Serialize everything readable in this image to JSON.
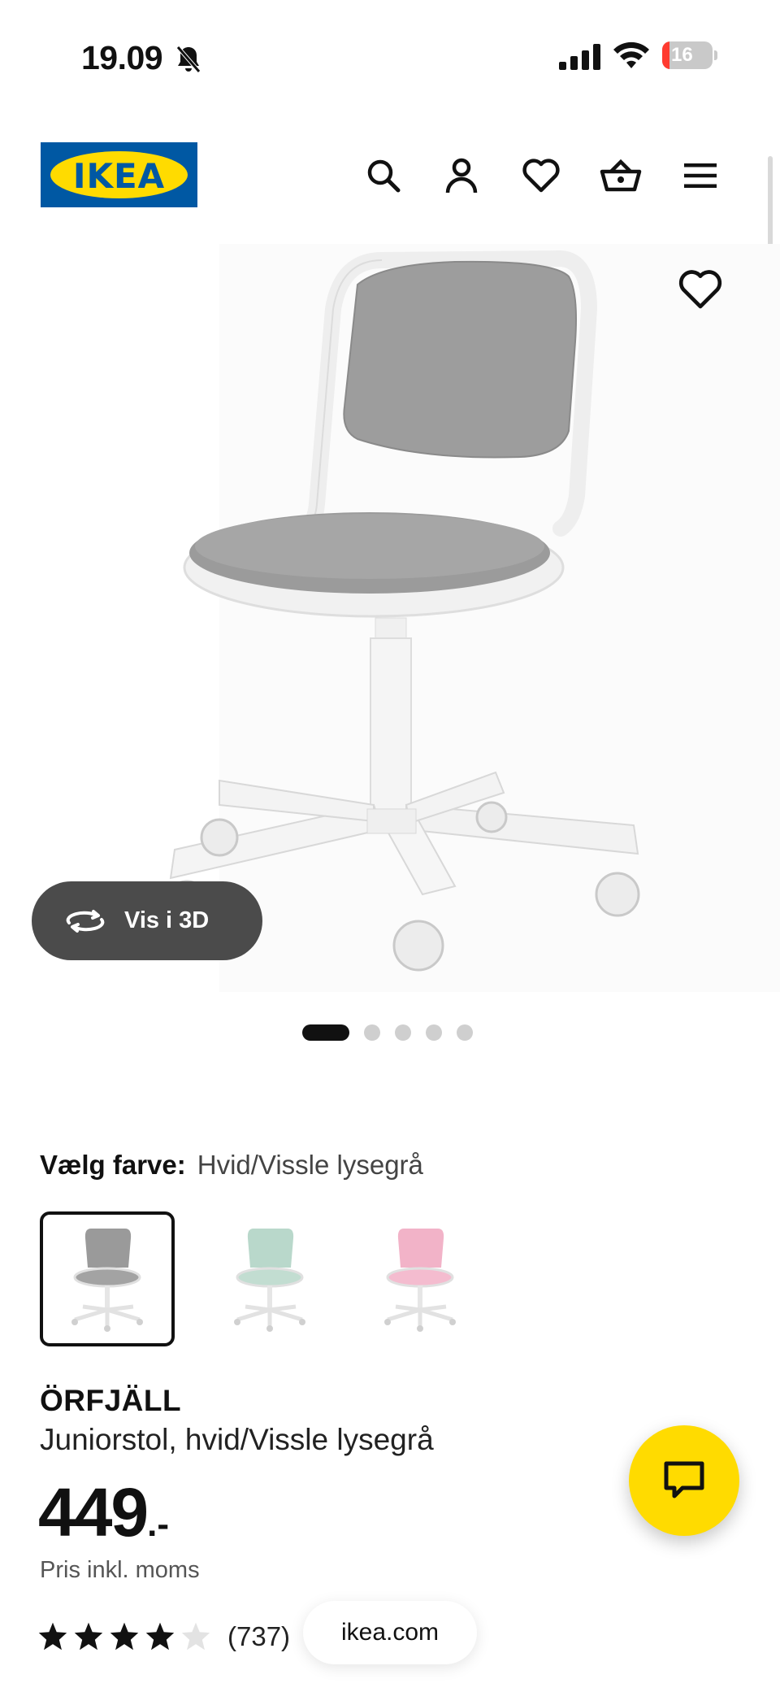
{
  "status_bar": {
    "time": "19.09",
    "battery": "16"
  },
  "header": {
    "logo_text": "IKEA",
    "icons": [
      "search-icon",
      "account-icon",
      "favourites-icon",
      "basket-icon",
      "menu-icon"
    ]
  },
  "gallery": {
    "view_3d_label": "Vis i 3D",
    "image_count": 5,
    "active_index": 0
  },
  "color_select": {
    "label": "Vælg farve:",
    "value": "Hvid/Vissle lysegrå",
    "options": [
      {
        "seat_color": "#9a9a9a",
        "selected": true
      },
      {
        "seat_color": "#b9d8cb",
        "selected": false
      },
      {
        "seat_color": "#f2b3c8",
        "selected": false
      }
    ]
  },
  "product": {
    "name": "ÖRFJÄLL",
    "description": "Juniorstol, hvid/Vissle lysegrå",
    "price": "449",
    "price_suffix": ".-",
    "price_note": "Pris inkl. moms",
    "rating": 4,
    "rating_max": 5,
    "review_count": "(737)"
  },
  "browser": {
    "site": "ikea.com"
  },
  "colors": {
    "ikea_blue": "#0058a3",
    "ikea_yellow": "#ffdb00",
    "seat_grey": "#9a9a9a"
  }
}
